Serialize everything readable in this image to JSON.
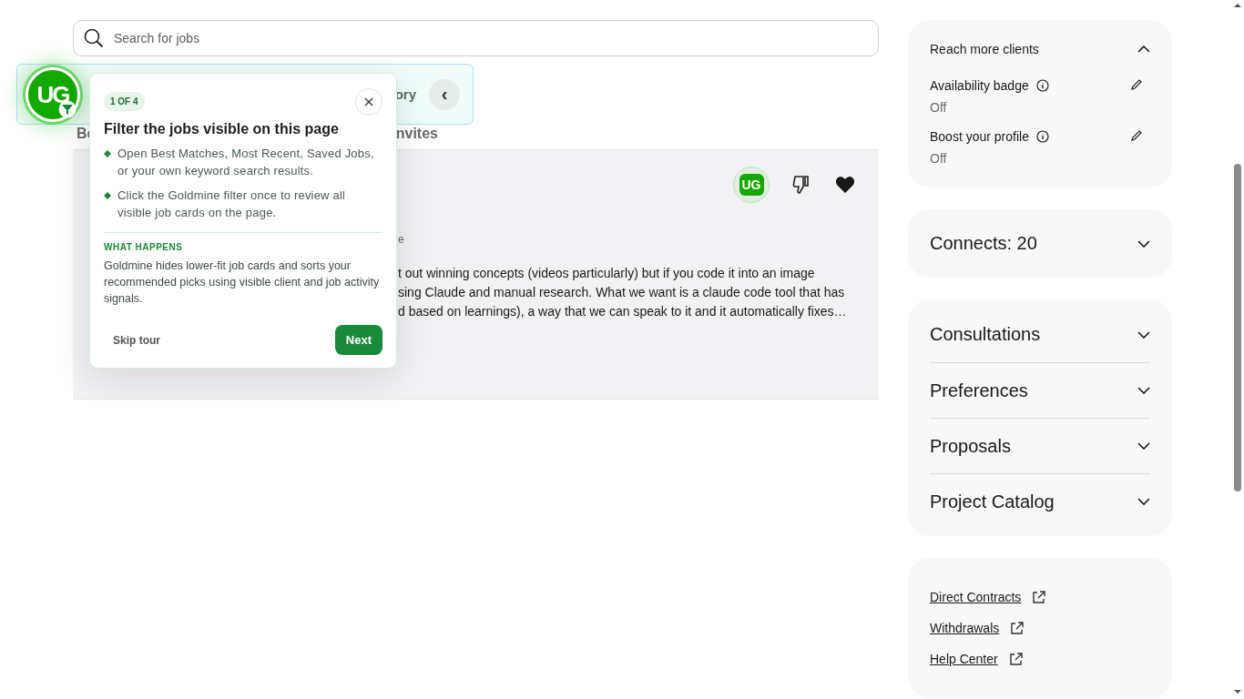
{
  "search": {
    "placeholder": "Search for jobs"
  },
  "toolbar": {
    "label": "ory",
    "collapse": "‹"
  },
  "tabs": [
    {
      "label": "Be",
      "selected": false
    },
    {
      "label": "nvites",
      "selected": false
    }
  ],
  "job": {
    "badge": "UG",
    "fragment": "e",
    "description_lines": [
      "t out winning concepts (videos particularly) but if you code it into an image",
      "sing Claude and manual research. What we want is a claude code tool that has",
      "d based on learnings), a way that we can speak to it and it automatically fixes…"
    ],
    "liked": true
  },
  "floating_button": {
    "label": "UG"
  },
  "tour": {
    "step": "1 OF 4",
    "title": "Filter the jobs visible on this page",
    "bullets": [
      "Open Best Matches, Most Recent, Saved Jobs, or your own keyword search results.",
      "Click the Goldmine filter once to review all visible job cards on the page."
    ],
    "section_label": "WHAT HAPPENS",
    "section_text": "Goldmine hides lower-fit job cards and sorts your recommended picks using visible client and job activity signals.",
    "skip": "Skip tour",
    "next": "Next"
  },
  "sidebar": {
    "reach": {
      "title": "Reach more clients",
      "expanded": true,
      "items": [
        {
          "label": "Availability badge",
          "value": "Off"
        },
        {
          "label": "Boost your profile",
          "value": "Off"
        }
      ]
    },
    "connects": {
      "title": "Connects: 20",
      "expanded": false
    },
    "sections": [
      {
        "title": "Consultations",
        "expanded": false
      },
      {
        "title": "Preferences",
        "expanded": false
      },
      {
        "title": "Proposals",
        "expanded": false
      },
      {
        "title": "Project Catalog",
        "expanded": false
      }
    ],
    "links": [
      "Direct Contracts",
      "Withdrawals",
      "Help Center"
    ]
  }
}
